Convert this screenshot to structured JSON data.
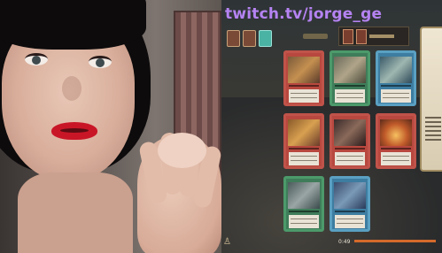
{
  "stream": {
    "url_text": "twitch.tv/jorge_ge"
  },
  "colors": {
    "url_purple": "#b583f2",
    "timer_bar": "#d46a2b",
    "card_red": "#c0534a",
    "card_green": "#4c9a6a",
    "card_blue": "#5aa0c2"
  },
  "game": {
    "timer_text": "0:49",
    "cards": [
      {
        "color": "red"
      },
      {
        "color": "green"
      },
      {
        "color": "blue"
      },
      {
        "color": "red"
      },
      {
        "color": "red"
      },
      {
        "color": "red"
      },
      {
        "color": "green"
      },
      {
        "color": "blue"
      }
    ],
    "icons": [
      "deck-icon",
      "gem-icon",
      "settings-icon"
    ]
  }
}
